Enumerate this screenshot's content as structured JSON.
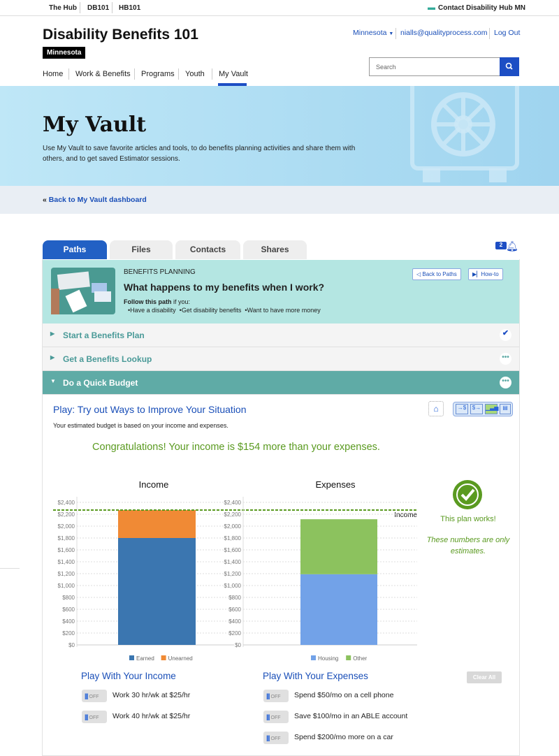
{
  "topbar": {
    "links": [
      "The Hub",
      "DB101",
      "HB101"
    ],
    "contact": "Contact Disability Hub MN"
  },
  "header": {
    "title": "Disability Benefits 101",
    "state_badge": "Minnesota",
    "state_menu": "Minnesota",
    "user_email": "nialls@qualityprocess.com",
    "logout": "Log Out",
    "search_placeholder": "Search"
  },
  "nav": [
    "Home",
    "Work & Benefits",
    "Programs",
    "Youth",
    "My Vault"
  ],
  "hero": {
    "title": "My Vault",
    "description": "Use My Vault to save favorite articles and tools, to do benefits planning activities and share them with others, and to get saved Estimator sessions."
  },
  "back_link": "Back to My Vault dashboard",
  "tabs": [
    "Paths",
    "Files",
    "Contacts",
    "Shares"
  ],
  "notification_count": "2",
  "path": {
    "category": "BENEFITS PLANNING",
    "title": "What happens to my benefits when I work?",
    "follow_bold": "Follow this path",
    "follow_rest": " if you:",
    "criteria": "•Have a disability  •Get disability benefits  •Want to have more money",
    "back_to_paths": "Back to Paths",
    "howto": "How-to"
  },
  "steps": [
    {
      "label": "Start a Benefits Plan",
      "status": "complete"
    },
    {
      "label": "Get a Benefits Lookup",
      "status": "more"
    },
    {
      "label": "Do a Quick Budget",
      "status": "open"
    }
  ],
  "budget": {
    "heading": "Play: Try out Ways to Improve Your Situation",
    "intro": "Your estimated budget is based on your income and expenses.",
    "congrats": "Congratulations! Your income is $154 more than your expenses.",
    "works": "This plan works!",
    "estimates": "These numbers are only estimates.",
    "income_heading": "Play With Your Income",
    "expense_heading": "Play With Your Expenses",
    "clear_all": "Clear All",
    "toggle_off": "OFF",
    "income_options": [
      "Work 30 hr/wk at $25/hr",
      "Work 40 hr/wk at $25/hr"
    ],
    "expense_options": [
      "Spend $50/mo on a cell phone",
      "Save $100/mo in an ABLE account",
      "Spend $200/mo more on a car"
    ]
  },
  "chart_data": [
    {
      "type": "bar",
      "stacked": true,
      "title": "Income",
      "ylim": [
        0,
        2400
      ],
      "ticks": [
        "$0",
        "$200",
        "$400",
        "$600",
        "$800",
        "$1,000",
        "$1,200",
        "$1,400",
        "$1,600",
        "$1,800",
        "$2,000",
        "$2,200",
        "$2,400"
      ],
      "series": [
        {
          "name": "Earned",
          "values": [
            1800
          ],
          "color": "#3b76b0"
        },
        {
          "name": "Unearned",
          "values": [
            470
          ],
          "color": "#f08a35"
        }
      ],
      "reference_line": {
        "label": "Income",
        "value": 2270,
        "color": "#5a9a20"
      },
      "grid": true,
      "legend": "bottom"
    },
    {
      "type": "bar",
      "stacked": true,
      "title": "Expenses",
      "ylim": [
        0,
        2400
      ],
      "ticks": [
        "$0",
        "$200",
        "$400",
        "$600",
        "$800",
        "$1,000",
        "$1,200",
        "$1,400",
        "$1,600",
        "$1,800",
        "$2,000",
        "$2,200",
        "$2,400"
      ],
      "series": [
        {
          "name": "Housing",
          "values": [
            1190
          ],
          "color": "#72a2e8"
        },
        {
          "name": "Other",
          "values": [
            926
          ],
          "color": "#8cc25e"
        }
      ],
      "grid": true,
      "legend": "bottom"
    }
  ]
}
